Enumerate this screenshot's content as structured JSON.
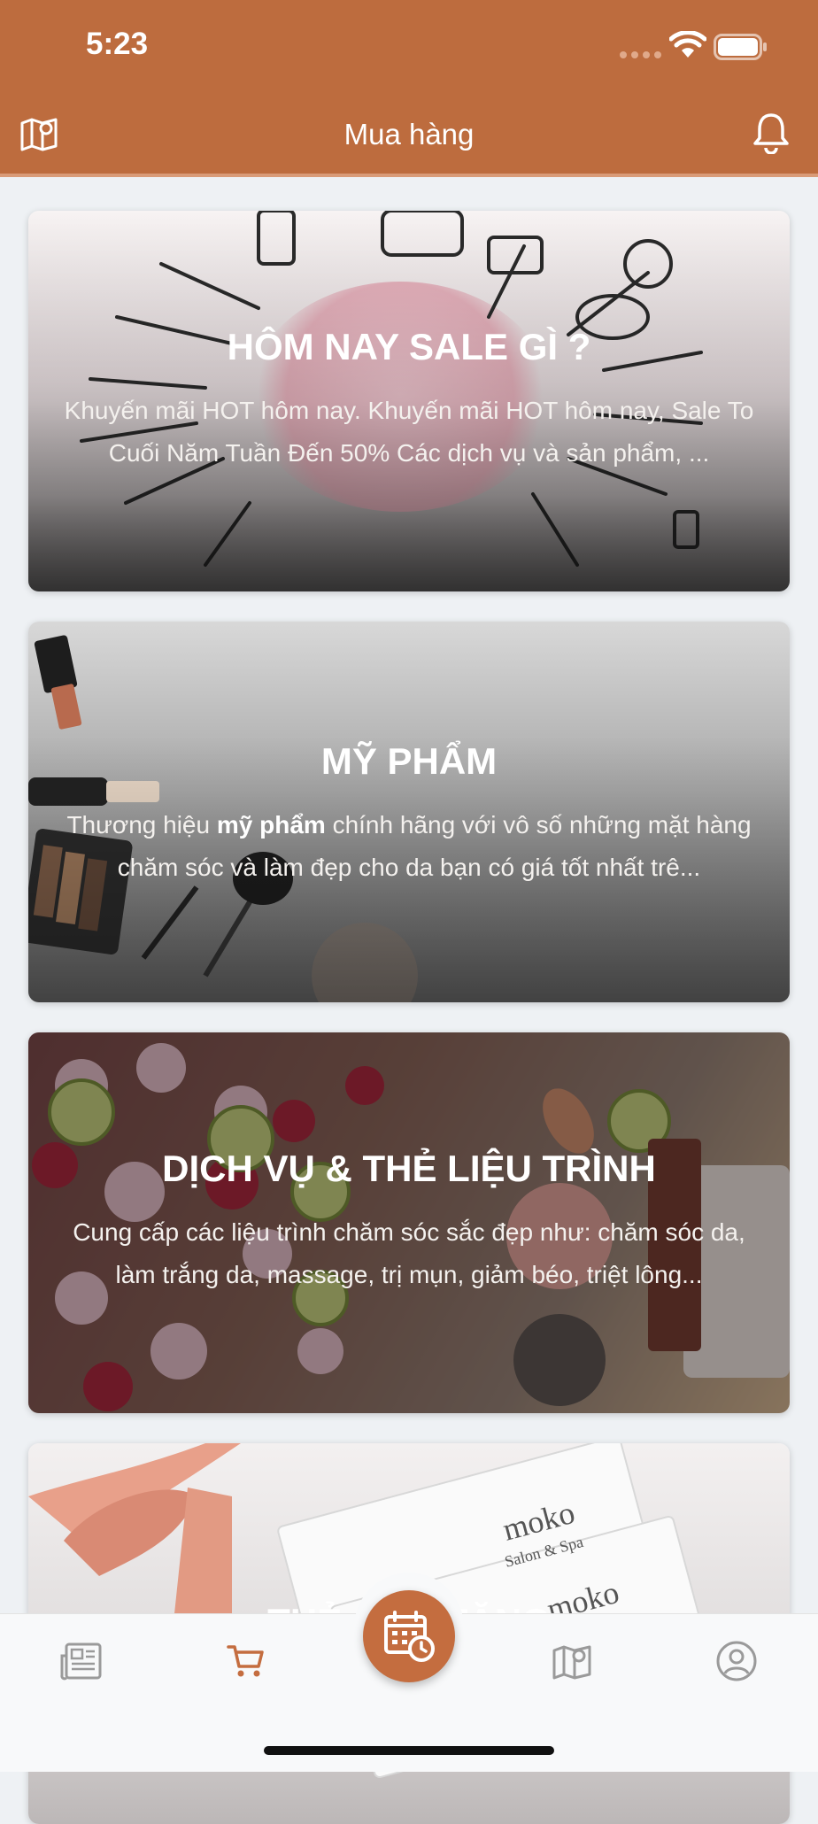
{
  "status_bar": {
    "time": "5:23"
  },
  "header": {
    "title": "Mua hàng",
    "left_icon": "map-icon",
    "right_icon": "bell-icon"
  },
  "cards": [
    {
      "title": "HÔM NAY SALE GÌ ?",
      "description": "Khuyến mãi HOT hôm nay. Khuyến mãi HOT hôm nay, Sale To Cuối Năm Tuần Đến 50% Các dịch vụ và sản phẩm, ..."
    },
    {
      "title": "MỸ PHẨM",
      "description_pre": "Thương hiệu ",
      "description_bold": "mỹ phẩm",
      "description_post": " chính hãng với vô số những mặt hàng chăm sóc và làm đẹp cho da bạn có giá tốt nhất trê..."
    },
    {
      "title": "DỊCH VỤ & THẺ LIỆU TRÌNH",
      "description": "Cung cấp các liệu trình chăm sóc sắc đẹp như: chăm sóc da, làm trắng da, massage, trị mụn, giảm béo, triệt lông..."
    },
    {
      "title": "THẺ QUÀ TẶNG",
      "brand_text": "moko",
      "brand_sub": "Salon & Spa"
    }
  ],
  "tabbar": {
    "items": [
      "news-icon",
      "cart-icon",
      "calendar-clock-icon",
      "map-icon",
      "user-icon"
    ],
    "active": "cart-icon",
    "accent": "#c46d3f"
  },
  "colors": {
    "header_bg": "#bd6c3e",
    "accent": "#c46d3f"
  }
}
